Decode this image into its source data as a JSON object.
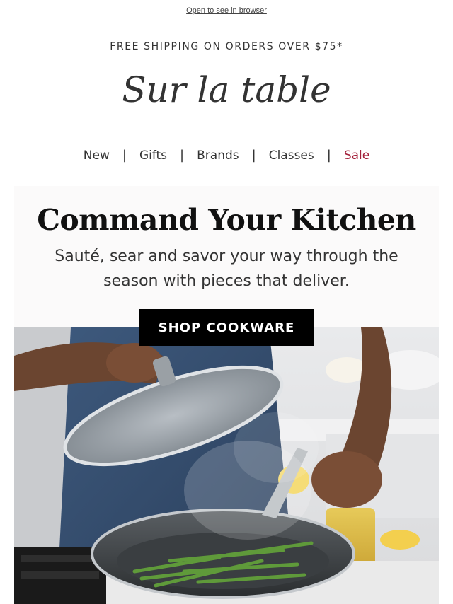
{
  "header": {
    "browser_link": "Open to see in browser",
    "shipping_banner": "FREE SHIPPING ON ORDERS OVER $75*",
    "logo_text": "Sur la table"
  },
  "nav": {
    "items": [
      {
        "label": "New"
      },
      {
        "label": "Gifts"
      },
      {
        "label": "Brands"
      },
      {
        "label": "Classes"
      },
      {
        "label": "Sale"
      }
    ],
    "separator": "|",
    "sale_color": "#a3203a"
  },
  "hero": {
    "title": "Command Your Kitchen",
    "subtitle": "Sauté, sear and savor your way through the season with pieces that deliver.",
    "cta_label": "SHOP COOKWARE"
  }
}
